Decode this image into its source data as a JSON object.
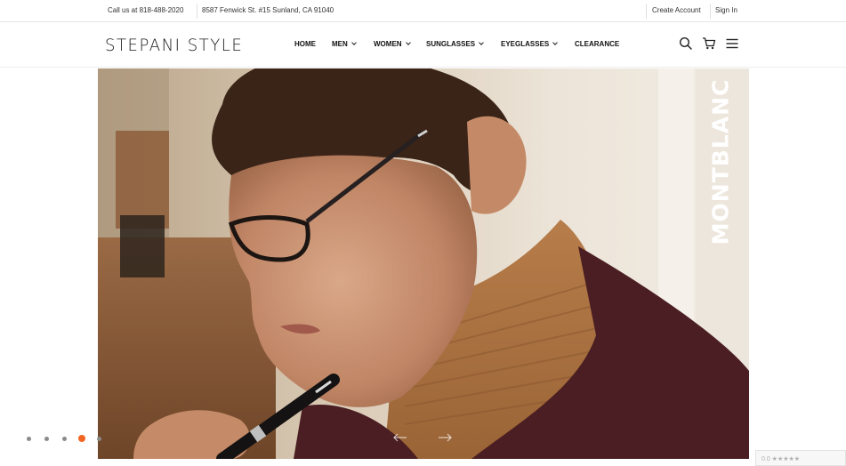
{
  "topbar": {
    "phone": "Call us at 818-488-2020",
    "address": "8587 Fenwick St. #15 Sunland, CA 91040",
    "create_account": "Create Account",
    "sign_in": "Sign In"
  },
  "header": {
    "logo": "STEPANI STYLE",
    "nav": [
      {
        "label": "HOME",
        "has_dropdown": false
      },
      {
        "label": "MEN",
        "has_dropdown": true
      },
      {
        "label": "WOMEN",
        "has_dropdown": true
      },
      {
        "label": "SUNGLASSES",
        "has_dropdown": true
      },
      {
        "label": "EYEGLASSES",
        "has_dropdown": true
      },
      {
        "label": "CLEARANCE",
        "has_dropdown": false
      }
    ],
    "icons": [
      "search-icon",
      "cart-icon",
      "menu-icon"
    ]
  },
  "hero": {
    "brand": "MONTBLANC",
    "slides_total": 5,
    "active_slide": 4
  },
  "badge": {
    "text": "0.0 ★★★★★"
  },
  "colors": {
    "accent": "#f26522",
    "dot": "#8a8a8a"
  }
}
